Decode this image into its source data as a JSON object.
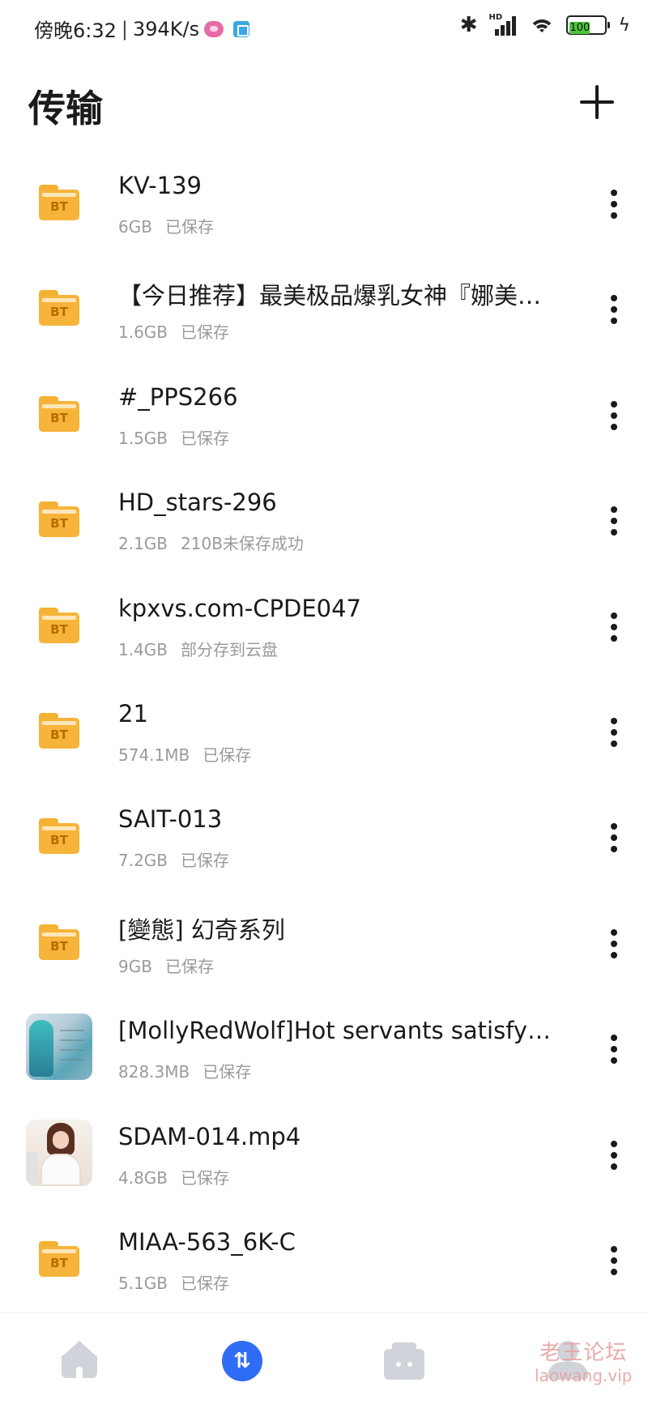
{
  "status_bar": {
    "time": "傍晚6:32",
    "separator": "|",
    "speed": "394K/s",
    "network_label": "HD",
    "battery": "100"
  },
  "header": {
    "title": "传输"
  },
  "transfers": [
    {
      "name": "KV-139",
      "size": "6GB",
      "status": "已保存",
      "thumb": "bt-folder"
    },
    {
      "name": "【今日推荐】最美极品爆乳女神『娜美…",
      "size": "1.6GB",
      "status": "已保存",
      "thumb": "bt-folder"
    },
    {
      "name": "#_PPS266",
      "size": "1.5GB",
      "status": "已保存",
      "thumb": "bt-folder"
    },
    {
      "name": "HD_stars-296",
      "size": "2.1GB",
      "status": "210B未保存成功",
      "thumb": "bt-folder"
    },
    {
      "name": "kpxvs.com-CPDE047",
      "size": "1.4GB",
      "status": "部分存到云盘",
      "thumb": "bt-folder"
    },
    {
      "name": "21",
      "size": "574.1MB",
      "status": "已保存",
      "thumb": "bt-folder"
    },
    {
      "name": "SAIT-013",
      "size": "7.2GB",
      "status": "已保存",
      "thumb": "bt-folder"
    },
    {
      "name": "[變態] 幻奇系列",
      "size": "9GB",
      "status": "已保存",
      "thumb": "bt-folder"
    },
    {
      "name": "[MollyRedWolf]Hot servants satisfy…",
      "size": "828.3MB",
      "status": "已保存",
      "thumb": "image"
    },
    {
      "name": "SDAM-014.mp4",
      "size": "4.8GB",
      "status": "已保存",
      "thumb": "video"
    },
    {
      "name": "MIAA-563_6K-C",
      "size": "5.1GB",
      "status": "已保存",
      "thumb": "bt-folder"
    }
  ],
  "folder_badge": "BT",
  "bottom_nav": {
    "items": [
      "home-icon",
      "transfer-icon",
      "share-icon",
      "profile-icon"
    ],
    "active_color": "#2e6cf5",
    "transfer_glyph": "⇅"
  },
  "watermark": {
    "cn": "老王论坛",
    "en": "laowang.vip"
  }
}
